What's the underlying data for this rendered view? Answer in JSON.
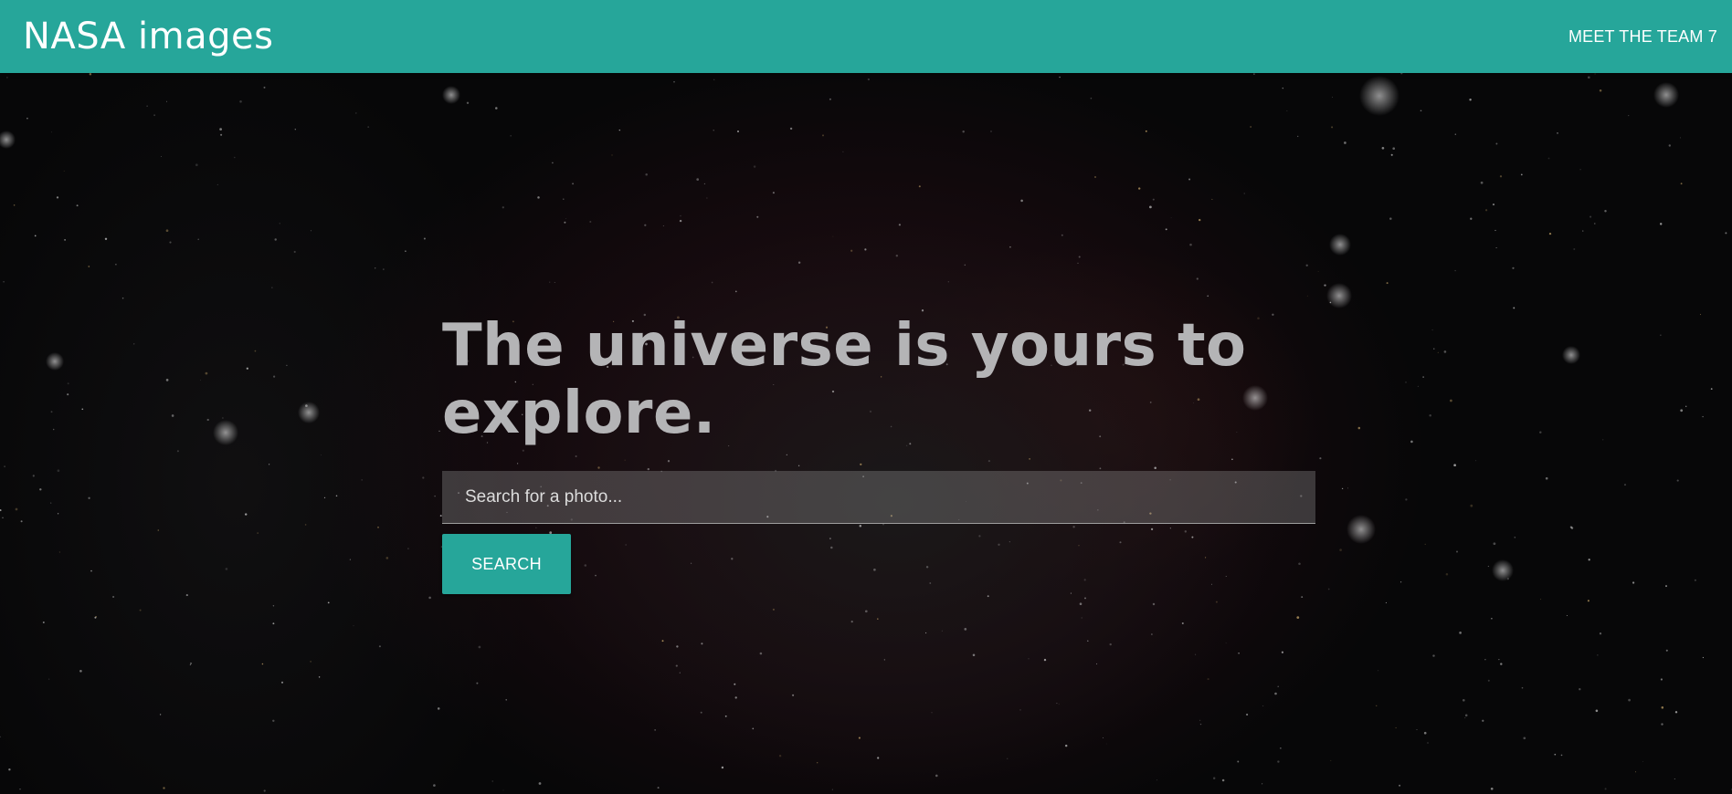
{
  "navbar": {
    "brand": "NASA images",
    "link_label": "MEET THE TEAM 7",
    "color": "#26a69a"
  },
  "hero": {
    "headline_line1": "The universe is yours to",
    "headline_line2": "explore.",
    "search": {
      "placeholder": "Search for a photo...",
      "value": ""
    },
    "search_button_label": "SEARCH",
    "background_image": "space-nebula-background"
  },
  "colors": {
    "accent": "#26a69a",
    "headline": "#b4b4b6",
    "background": "#070708"
  }
}
